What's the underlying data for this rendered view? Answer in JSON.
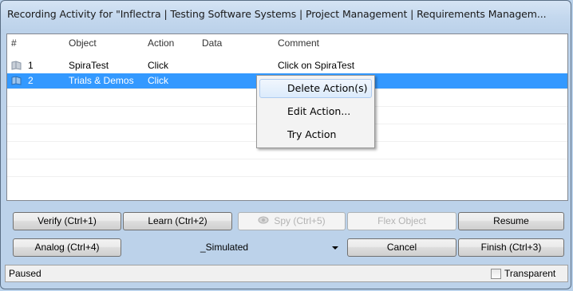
{
  "window": {
    "title": "Recording Activity for \"Inflectra | Testing Software Systems | Project Management | Requirements Managem..."
  },
  "list": {
    "columns": [
      "#",
      "Object",
      "Action",
      "Data",
      "Comment"
    ],
    "rows": [
      {
        "num": "1",
        "object": "SpiraTest",
        "action": "Click",
        "data": "",
        "comment": "Click on SpiraTest",
        "selected": false,
        "icon": "action-icon"
      },
      {
        "num": "2",
        "object": "Trials & Demos",
        "action": "Click",
        "data": "",
        "comment": "",
        "selected": true,
        "icon": "action-icon"
      }
    ]
  },
  "context_menu": {
    "items": [
      {
        "label": "Delete Action(s)",
        "highlighted": true
      },
      {
        "label": "Edit Action...",
        "highlighted": false
      },
      {
        "label": "Try Action",
        "highlighted": false
      }
    ]
  },
  "buttons": {
    "verify": "Verify (Ctrl+1)",
    "learn": "Learn (Ctrl+2)",
    "spy": "Spy (Ctrl+5)",
    "flex_object": "Flex Object",
    "resume": "Resume",
    "analog": "Analog (Ctrl+4)",
    "cancel": "Cancel",
    "finish": "Finish (Ctrl+3)"
  },
  "mode_select": {
    "value": "_Simulated"
  },
  "status": {
    "text": "Paused",
    "transparent_label": "Transparent",
    "transparent_checked": false
  },
  "colors": {
    "selection": "#3399ff",
    "window_frame": "#bcd2ea"
  }
}
